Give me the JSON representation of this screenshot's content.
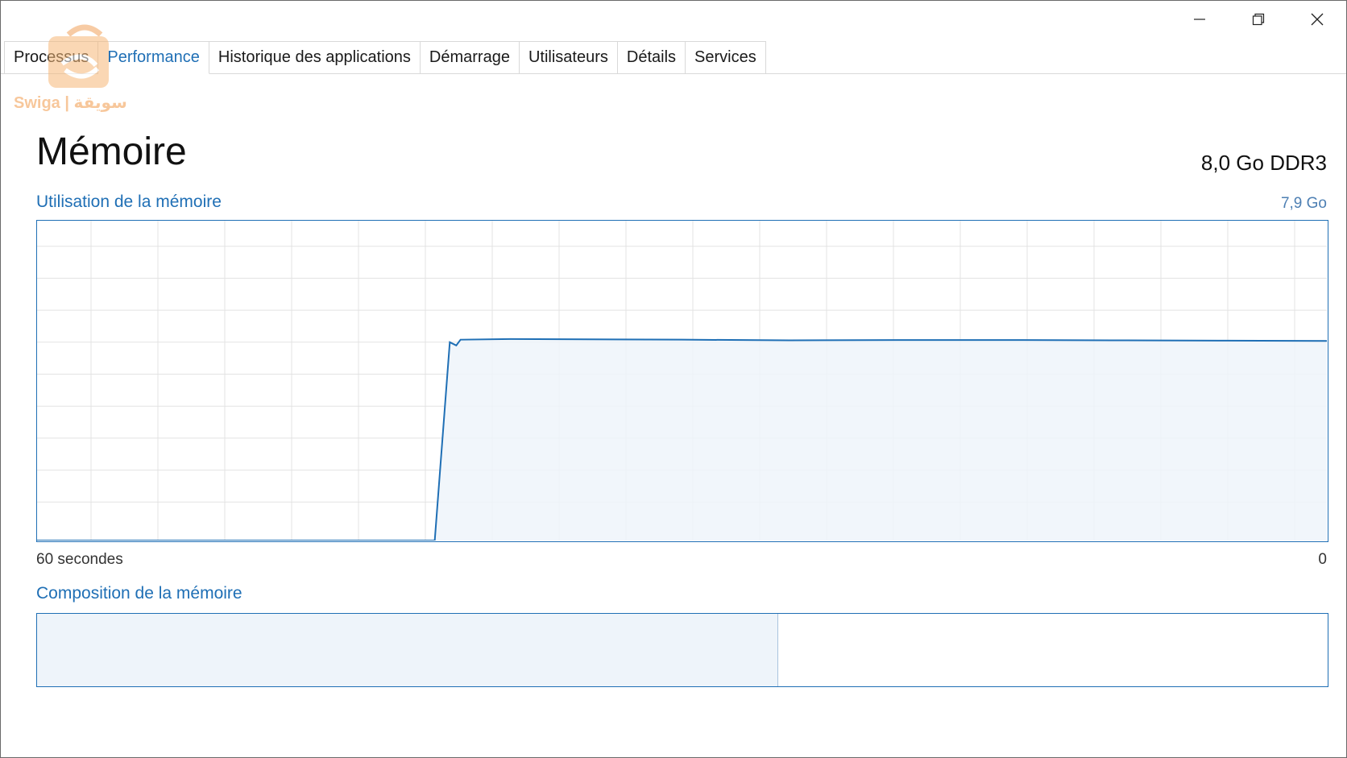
{
  "window": {
    "controls": {
      "minimize_icon": "minimize-icon",
      "maximize_icon": "restore-icon",
      "close_icon": "close-icon"
    }
  },
  "tabs": [
    {
      "label": "Processus",
      "active": false
    },
    {
      "label": "Performance",
      "active": true
    },
    {
      "label": "Historique des applications",
      "active": false
    },
    {
      "label": "Démarrage",
      "active": false
    },
    {
      "label": "Utilisateurs",
      "active": false
    },
    {
      "label": "Détails",
      "active": false
    },
    {
      "label": "Services",
      "active": false
    }
  ],
  "watermark": {
    "text": "Swiga | سويقة"
  },
  "main": {
    "title": "Mémoire",
    "spec": "8,0 Go DDR3",
    "usage_label": "Utilisation de la mémoire",
    "usage_max": "7,9 Go",
    "axis_left": "60 secondes",
    "axis_right": "0",
    "composition_label": "Composition de la mémoire"
  },
  "chart_data": {
    "type": "area",
    "x_range_seconds": [
      60,
      0
    ],
    "y_range_fraction": [
      0,
      1
    ],
    "grid": true,
    "points": [
      {
        "t": 60,
        "v": 0
      },
      {
        "t": 41.5,
        "v": 0
      },
      {
        "t": 40.8,
        "v": 0.62
      },
      {
        "t": 40.5,
        "v": 0.61
      },
      {
        "t": 40.3,
        "v": 0.628
      },
      {
        "t": 38,
        "v": 0.63
      },
      {
        "t": 30,
        "v": 0.628
      },
      {
        "t": 25,
        "v": 0.626
      },
      {
        "t": 20,
        "v": 0.627
      },
      {
        "t": 15,
        "v": 0.627
      },
      {
        "t": 10,
        "v": 0.626
      },
      {
        "t": 5,
        "v": 0.625
      },
      {
        "t": 0,
        "v": 0.624
      }
    ],
    "line_color": "#1f6fb5",
    "fill_color": "#eef4fa",
    "grid_color": "#e3e3e3"
  },
  "composition": {
    "segments": [
      {
        "fraction": 0.574,
        "fill": "#eef4fa"
      },
      {
        "fraction": 0.426,
        "fill": "#ffffff"
      }
    ],
    "divider_color": "#a9c3de"
  }
}
